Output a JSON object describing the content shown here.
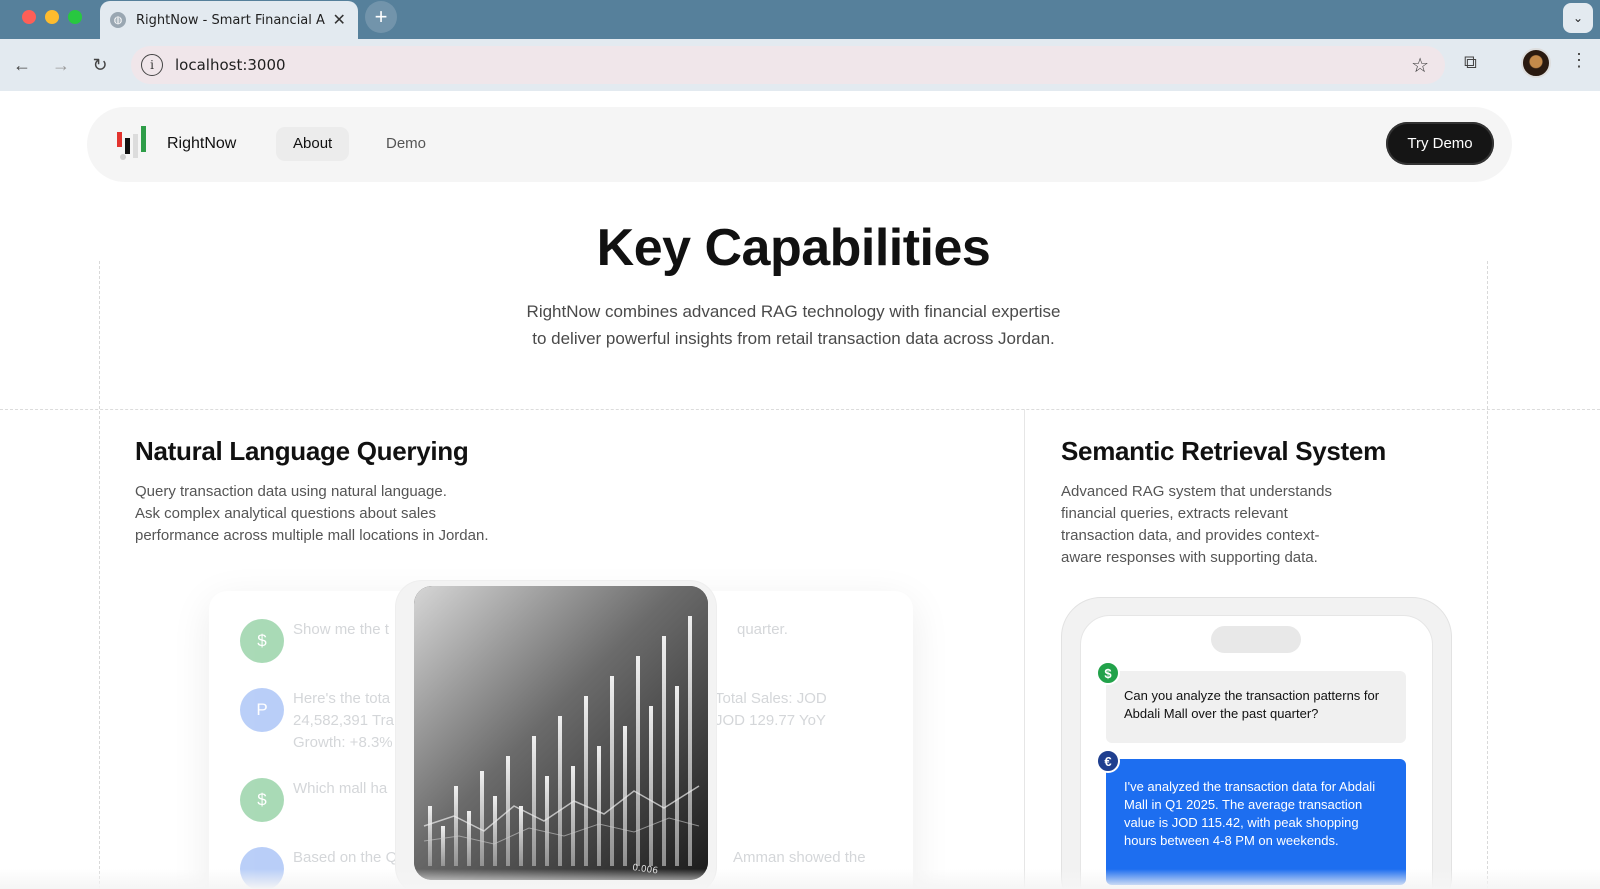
{
  "browser": {
    "tab_title": "RightNow - Smart Financial A",
    "url": "localhost:3000",
    "traffic_lights": [
      "#ff5f57",
      "#febc2e",
      "#28c840"
    ]
  },
  "nav": {
    "brand": "RightNow",
    "links": [
      "About",
      "Demo"
    ],
    "cta": "Try Demo"
  },
  "hero": {
    "title": "Key Capabilities",
    "subtitle_line1": "RightNow combines advanced RAG technology with financial expertise",
    "subtitle_line2": "to deliver powerful insights from retail transaction data across Jordan."
  },
  "features": [
    {
      "title": "Natural Language Querying",
      "desc_lines": [
        "Query transaction data using natural language.",
        "Ask complex analytical questions about sales",
        "performance across multiple mall locations in Jordan."
      ]
    },
    {
      "title": "Semantic Retrieval System",
      "desc_lines": [
        "Advanced RAG system that understands",
        "financial queries, extracts relevant",
        "transaction data, and provides context-",
        "aware responses with supporting data."
      ]
    }
  ],
  "left_demo": {
    "ghost_rows": [
      {
        "avatar": "$",
        "color": "#34a853",
        "text_a": "Show me the t",
        "text_b": "quarter."
      },
      {
        "avatar": "P",
        "color": "#5b8def",
        "text_a": "Here's the tota",
        "text_b": "Total Sales: JOD",
        "text_c": "24,582,391 Tra",
        "text_d": "JOD 129.77 YoY",
        "text_e": "Growth: +8.3%"
      },
      {
        "avatar": "$",
        "color": "#34a853",
        "text_a": "Which mall ha",
        "text_b": ""
      },
      {
        "avatar": "",
        "color": "#5b8def",
        "text_a": "Based on the Q",
        "text_b": "Amman showed the"
      }
    ],
    "photo_label": "0.006"
  },
  "right_demo": {
    "question": "Can you analyze the transaction patterns for Abdali Mall over the past quarter?",
    "answer": "I've analyzed the transaction data for Abdali Mall in Q1 2025. The average transaction value is JOD 115.42, with peak shopping hours between 4-8 PM on weekends.",
    "user_badge": "$",
    "bot_badge": "€"
  }
}
